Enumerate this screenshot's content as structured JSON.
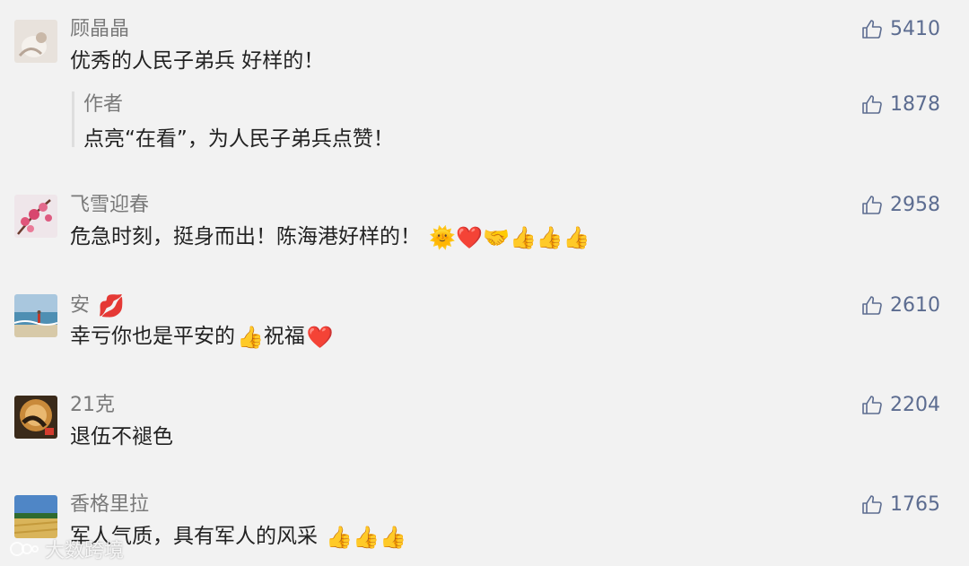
{
  "comments": [
    {
      "name": "顾晶晶",
      "text": "优秀的人民子弟兵 好样的！",
      "likes": "5410",
      "reply": {
        "name": "作者",
        "text": "点亮“在看”，为人民子弟兵点赞！",
        "likes": "1878"
      }
    },
    {
      "name": "飞雪迎春",
      "text": "危急时刻，挺身而出！陈海港好样的！",
      "emojis": "🌞❤️🤝👍👍👍",
      "likes": "2958"
    },
    {
      "name": "安",
      "name_emoji": "💋",
      "text": "幸亏你也是平安的",
      "emoji_mid": "👍",
      "text_tail": "祝福",
      "emoji_end": "❤️",
      "likes": "2610"
    },
    {
      "name": "21克",
      "text": "退伍不褪色",
      "likes": "2204"
    },
    {
      "name": "香格里拉",
      "text": "军人气质，具有军人的风采",
      "emojis": "👍👍👍",
      "likes": "1765"
    }
  ],
  "watermark": "大数跨境",
  "colors": {
    "background": "#f2f2f2",
    "like": "#5c6c90",
    "name": "#7a7a7a",
    "text": "#222222"
  },
  "icons": {
    "like": "thumbs-up-outline-icon"
  }
}
